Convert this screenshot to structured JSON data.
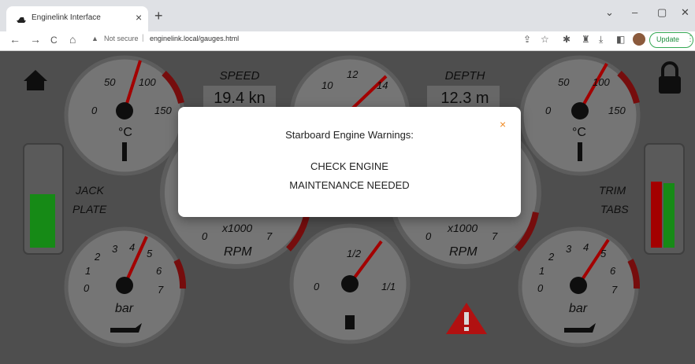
{
  "browser": {
    "tab_title": "Enginelink Interface",
    "tab_close": "×",
    "new_tab": "+",
    "controls": {
      "dropdown": "⌄",
      "minimize": "–",
      "maximize": "▢",
      "close": "✕"
    },
    "nav": {
      "back": "←",
      "forward": "→",
      "reload": "C",
      "home": "⌂"
    },
    "security_label": "Not secure",
    "url": "enginelink.local/gauges.html",
    "update_label": "Update"
  },
  "dashboard": {
    "panel_bg": "#5c5c5c",
    "gauge_face": "#8a8a8a",
    "needle_color": "#c00000",
    "redzone_color": "#8b1010",
    "speed": {
      "label": "SPEED",
      "value": "19.4 kn"
    },
    "depth": {
      "label": "DEPTH",
      "value": "12.3 m"
    },
    "temp_left": {
      "ticks": [
        "0",
        "50",
        "100",
        "150"
      ],
      "unit": "°C"
    },
    "temp_right": {
      "ticks": [
        "0",
        "50",
        "100",
        "150"
      ],
      "unit": "°C"
    },
    "knots": {
      "ticks": [
        "10",
        "12",
        "14"
      ]
    },
    "rpm_left": {
      "ticks": [
        "0",
        "x1000",
        "7"
      ],
      "unit": "RPM"
    },
    "rpm_right": {
      "ticks": [
        "0",
        "x1000",
        "7"
      ],
      "unit": "RPM"
    },
    "oil_left": {
      "ticks": [
        "0",
        "1",
        "2",
        "3",
        "4",
        "5",
        "6",
        "7"
      ],
      "unit": "bar"
    },
    "oil_right": {
      "ticks": [
        "0",
        "1",
        "2",
        "3",
        "4",
        "5",
        "6",
        "7"
      ],
      "unit": "bar"
    },
    "fuel": {
      "ticks": [
        "0",
        "1/2",
        "1/1"
      ]
    },
    "jack_plate": {
      "line1": "JACK",
      "line2": "PLATE",
      "level": 0.55,
      "color": "#1aa31a"
    },
    "trim_tabs": {
      "line1": "TRIM",
      "line2": "TABS",
      "left_level": 0.68,
      "right_level": 0.66,
      "left_color": "#c00000",
      "right_color": "#1aa31a"
    }
  },
  "dialog": {
    "title": "Starboard Engine Warnings:",
    "close": "×",
    "lines": [
      "CHECK ENGINE",
      "MAINTENANCE NEEDED"
    ]
  }
}
